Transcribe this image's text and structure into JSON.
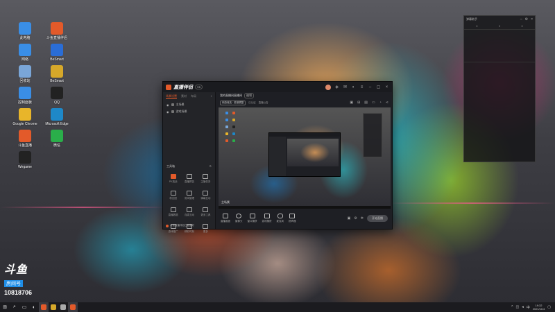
{
  "desktop": {
    "left_icons": [
      {
        "label": "此电脑",
        "icon": "computer-icon",
        "color": "#3a8ee6"
      },
      {
        "label": "斗鱼直播伴侣",
        "icon": "douyu-icon",
        "color": "#e35a2a"
      },
      {
        "label": "网络",
        "icon": "network-icon",
        "color": "#3a8ee6"
      },
      {
        "label": "BeSmart",
        "icon": "app-icon",
        "color": "#2a6dd6"
      },
      {
        "label": "回收站",
        "icon": "recycle-bin-icon",
        "color": "#7aa6d8"
      },
      {
        "label": "BeSmart",
        "icon": "app-icon",
        "color": "#d6a82a"
      },
      {
        "label": "控制面板",
        "icon": "control-panel-icon",
        "color": "#3a8ee6"
      },
      {
        "label": "QQ",
        "icon": "qq-icon",
        "color": "#222222"
      },
      {
        "label": "Google Chrome",
        "icon": "chrome-icon",
        "color": "#e8b52a"
      },
      {
        "label": "Microsoft Edge",
        "icon": "edge-icon",
        "color": "#1e88c8"
      },
      {
        "label": "斗鱼直播",
        "icon": "douyu-icon",
        "color": "#e35a2a"
      },
      {
        "label": "微信",
        "icon": "wechat-icon",
        "color": "#2aae4a"
      },
      {
        "label": "Wegame",
        "icon": "wegame-icon",
        "color": "#222222"
      }
    ]
  },
  "ghost_window": {
    "title": "弹幕助手",
    "cols": [
      "0",
      "0",
      "0"
    ]
  },
  "app": {
    "logo": "直播伴侣",
    "version": "V5",
    "left_tabs": [
      "场景设置",
      "素材",
      "布局"
    ],
    "scenes": [
      "主场景",
      "游戏场景"
    ],
    "toolbox_title": "工具箱",
    "tools": [
      {
        "label": "PK挑战",
        "hot": true
      },
      {
        "label": "直播预告",
        "hot": false
      },
      {
        "label": "主播任务",
        "hot": false
      },
      {
        "label": "粉丝团",
        "hot": false
      },
      {
        "label": "房间管理",
        "hot": false
      },
      {
        "label": "弹幕互动",
        "hot": false
      },
      {
        "label": "直播数据",
        "hot": false
      },
      {
        "label": "连麦互动",
        "hot": false
      },
      {
        "label": "更多工具",
        "hot": false
      },
      {
        "label": "游戏推广",
        "hot": false
      },
      {
        "label": "精彩时刻",
        "hot": false
      },
      {
        "label": "更多",
        "hot": false
      }
    ],
    "footer_text": "斗鱼直播伴侣已准备好",
    "room_title": "我的直播间直播间",
    "room_tag": "编辑",
    "category": "网游竞技 · 英雄联盟",
    "cat_meta": [
      "已认证",
      "直播公告"
    ],
    "preview_label": "主场景",
    "bottom_tools": [
      "直播画面",
      "摄像头",
      "窗口捕获",
      "游戏捕获",
      "麦克风",
      "扬声器"
    ],
    "live_button": "开始直播"
  },
  "watermark": {
    "brand": "斗鱼",
    "sub": "房间号",
    "room": "10818706"
  },
  "taskbar": {
    "time": "19:32",
    "date": "2021/11/4"
  }
}
